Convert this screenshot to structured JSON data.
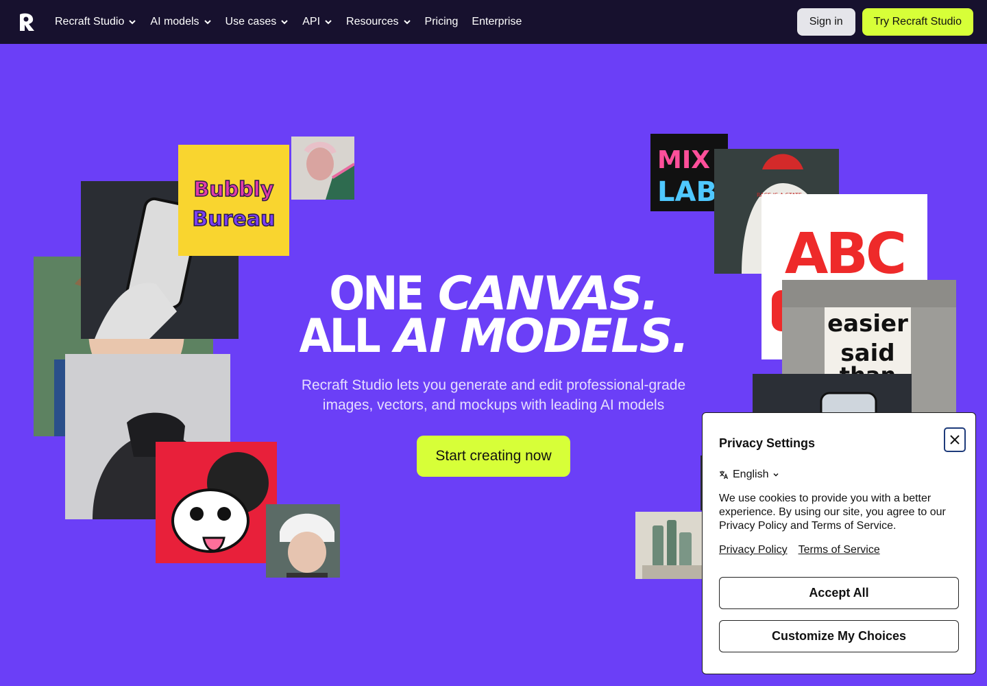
{
  "nav": {
    "logo": "R",
    "items": [
      {
        "label": "Recraft Studio",
        "dropdown": true
      },
      {
        "label": "AI models",
        "dropdown": true
      },
      {
        "label": "Use cases",
        "dropdown": true
      },
      {
        "label": "API",
        "dropdown": true
      },
      {
        "label": "Resources",
        "dropdown": true
      },
      {
        "label": "Pricing",
        "dropdown": false
      },
      {
        "label": "Enterprise",
        "dropdown": false
      }
    ],
    "signin_label": "Sign in",
    "try_label": "Try Recraft Studio"
  },
  "hero": {
    "line1_plain": "ONE",
    "line1_italic": "CANVAS.",
    "line2_plain": "ALL",
    "line2_italic": "AI MODELS.",
    "subtitle": "Recraft Studio lets you generate and edit professional-grade images, vectors, and mockups with leading AI models",
    "cta_label": "Start creating now"
  },
  "tiles": {
    "bubbly_text": "Bubbly Bureau",
    "abc_text": "ABC",
    "jacket_text": "RACE IS A STATE",
    "poster_text_1": "easier",
    "poster_text_2": "said",
    "poster_text_3": "than",
    "mix_text": "MIX LAB"
  },
  "cookie": {
    "title": "Privacy Settings",
    "language": "English",
    "text": "We use cookies to provide you with a better experience. By using our site, you agree to our Privacy Policy and Terms of Service.",
    "privacy_link": "Privacy Policy",
    "terms_link": "Terms of Service",
    "accept_label": "Accept All",
    "customize_label": "Customize My Choices"
  },
  "colors": {
    "background": "#6b3ff7",
    "nav_bg": "#17112e",
    "accent": "#d7ff38"
  }
}
